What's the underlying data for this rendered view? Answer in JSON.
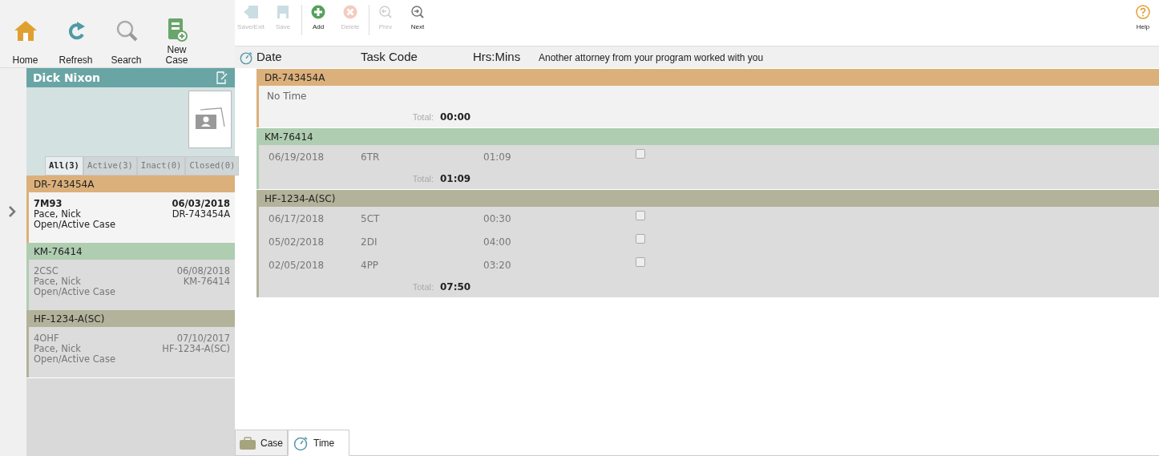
{
  "nav": [
    {
      "kind": "home",
      "label": "Home"
    },
    {
      "kind": "refresh",
      "label": "Refresh"
    },
    {
      "kind": "search",
      "label": "Search"
    },
    {
      "kind": "new",
      "label": "New Case"
    }
  ],
  "toolbar": [
    {
      "kind": "saveexit",
      "label": "Save/Exit",
      "disabled": true
    },
    {
      "kind": "save",
      "label": "Save",
      "disabled": true
    },
    {
      "kind": "add",
      "label": "Add",
      "disabled": false
    },
    {
      "kind": "delete",
      "label": "Delete",
      "disabled": true
    },
    {
      "kind": "prev",
      "label": "Prev",
      "disabled": true
    },
    {
      "kind": "next",
      "label": "Next",
      "disabled": false
    }
  ],
  "help": {
    "label": "Help"
  },
  "client": {
    "name": "Dick Nixon"
  },
  "filter_tabs": [
    {
      "label": "All(3)",
      "selected": true
    },
    {
      "label": "Active(3)",
      "selected": false
    },
    {
      "label": "Inact(0)",
      "selected": false
    },
    {
      "label": "Closed(0)",
      "selected": false
    }
  ],
  "cases": [
    {
      "code": "DR-743454A",
      "color": "#dcb07a",
      "selected": true,
      "task": "7M93",
      "date": "06/03/2018",
      "attorney": "Pace, Nick",
      "number": "DR-743454A",
      "status": "Open/Active Case"
    },
    {
      "code": "KM-76414",
      "color": "#afcdb1",
      "selected": false,
      "task": "2CSC",
      "date": "06/08/2018",
      "attorney": "Pace, Nick",
      "number": "KM-76414",
      "status": "Open/Active Case"
    },
    {
      "code": "HF-1234-A(SC)",
      "color": "#b3b29a",
      "selected": false,
      "task": "4OHF",
      "date": "07/10/2017",
      "attorney": "Pace, Nick",
      "number": "HF-1234-A(SC)",
      "status": "Open/Active Case"
    }
  ],
  "columns": [
    "Date",
    "Task Code",
    "Hrs:Mins",
    "Another attorney from your program worked with you"
  ],
  "groups": [
    {
      "code": "DR-743454A",
      "color": "#dcb07a",
      "empty_text": "No Time",
      "total_label": "Total:",
      "total": "00:00"
    },
    {
      "code": "KM-76414",
      "color": "#afcdb1",
      "entries": [
        {
          "date": "06/19/2018",
          "task": "6TR",
          "time": "01:09",
          "checked": false
        }
      ],
      "total_label": "Total:",
      "total": "01:09"
    },
    {
      "code": "HF-1234-A(SC)",
      "color": "#b3b29a",
      "entries": [
        {
          "date": "06/17/2018",
          "task": "5CT",
          "time": "00:30",
          "checked": false
        },
        {
          "date": "05/02/2018",
          "task": "2DI",
          "time": "04:00",
          "checked": false
        },
        {
          "date": "02/05/2018",
          "task": "4PP",
          "time": "03:20",
          "checked": false
        }
      ],
      "total_label": "Total:",
      "total": "07:50"
    }
  ],
  "bottom_tabs": [
    {
      "kind": "case",
      "label": "Case",
      "selected": false
    },
    {
      "kind": "time",
      "label": "Time",
      "selected": true
    }
  ]
}
